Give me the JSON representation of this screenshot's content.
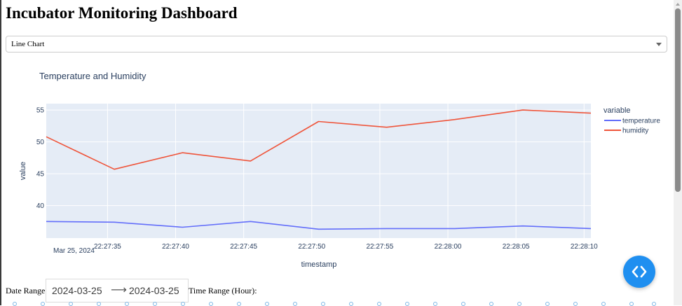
{
  "page": {
    "title": "Incubator Monitoring Dashboard"
  },
  "chart_select": {
    "selected": "Line Chart",
    "caret_icon": "chevron-down-icon"
  },
  "chart_data": {
    "type": "line",
    "title": "Temperature and Humidity",
    "xlabel": "timestamp",
    "ylabel": "value",
    "legend_title": "variable",
    "legend_position": "right",
    "date_label": "Mar 25, 2024",
    "x_ticks": [
      "22:27:35",
      "22:27:40",
      "22:27:45",
      "22:27:50",
      "22:27:55",
      "22:28:00",
      "22:28:05",
      "22:28:10"
    ],
    "x_tick_seconds": [
      35,
      40,
      45,
      50,
      55,
      60,
      65,
      70
    ],
    "y_ticks": [
      40,
      45,
      50,
      55
    ],
    "xlim_seconds": [
      30.5,
      70.5
    ],
    "ylim": [
      34.9,
      56
    ],
    "grid": true,
    "x_seconds": [
      30.5,
      35.5,
      40.5,
      45.5,
      50.5,
      55.5,
      60.5,
      65.5,
      70.5
    ],
    "series": [
      {
        "name": "temperature",
        "color": "#636efa",
        "values": [
          37.5,
          37.4,
          36.6,
          37.5,
          36.3,
          36.4,
          36.4,
          36.8,
          36.4
        ]
      },
      {
        "name": "humidity",
        "color": "#ef553b",
        "values": [
          50.8,
          45.7,
          48.3,
          47.0,
          53.2,
          52.3,
          53.5,
          55.0,
          54.5
        ]
      }
    ]
  },
  "controls": {
    "date_range_label": "Date Range:",
    "date_start": "2024-03-25",
    "date_end": "2024-03-25",
    "arrow": "⟶",
    "time_range_label": "Time Range (Hour):"
  },
  "fab": {
    "icon": "code-icon"
  }
}
